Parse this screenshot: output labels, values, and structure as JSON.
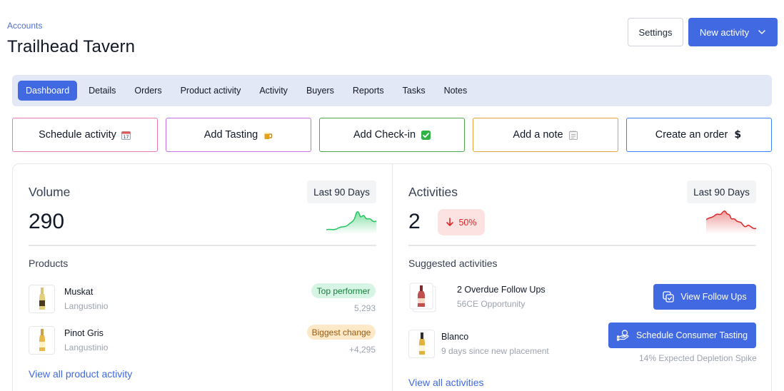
{
  "header": {
    "breadcrumb": "Accounts",
    "title": "Trailhead Tavern",
    "settings_label": "Settings",
    "new_activity_label": "New activity"
  },
  "tabs": [
    {
      "label": "Dashboard",
      "active": true
    },
    {
      "label": "Details"
    },
    {
      "label": "Orders"
    },
    {
      "label": "Product activity"
    },
    {
      "label": "Activity"
    },
    {
      "label": "Buyers"
    },
    {
      "label": "Reports"
    },
    {
      "label": "Tasks"
    },
    {
      "label": "Notes"
    }
  ],
  "quick_actions": [
    {
      "label": "Schedule activity",
      "icon": "calendar-icon",
      "border": "#e879b5"
    },
    {
      "label": "Add Tasting",
      "icon": "beer-mug-icon",
      "border": "#c86ff0"
    },
    {
      "label": "Add Check-in",
      "icon": "check-box-icon",
      "border": "#4aa84a"
    },
    {
      "label": "Add a note",
      "icon": "notepad-icon",
      "border": "#e6a23c"
    },
    {
      "label": "Create an order",
      "icon": "dollar-icon",
      "border": "#3b82f6"
    }
  ],
  "volume": {
    "title": "Volume",
    "range": "Last 90 Days",
    "value": "290",
    "sparkline_color": "#22c55e",
    "section_label": "Products",
    "products": [
      {
        "name": "Muskat",
        "producer": "Langustinio",
        "badge": "Top performer",
        "badge_tone": "green",
        "value": "5,293"
      },
      {
        "name": "Pinot Gris",
        "producer": "Langustinio",
        "badge": "Biggest change",
        "badge_tone": "amber",
        "value": "+4,295"
      }
    ],
    "link": "View all product activity"
  },
  "activities": {
    "title": "Activities",
    "range": "Last 90 Days",
    "value": "2",
    "change": "50%",
    "change_direction": "down",
    "sparkline_color": "#dc2626",
    "section_label": "Suggested activities",
    "suggestions": [
      {
        "title": "2 Overdue Follow Ups",
        "subtitle": "56CE Opportunity",
        "action": "View Follow Ups",
        "action_icon": "copy-check-icon"
      },
      {
        "title": "Blanco",
        "subtitle": "9 days since new placement",
        "action": "Schedule Consumer Tasting",
        "action_icon": "hand-coin-icon",
        "hint": "14% Expected Depletion Spike"
      }
    ],
    "link": "View all activities"
  }
}
